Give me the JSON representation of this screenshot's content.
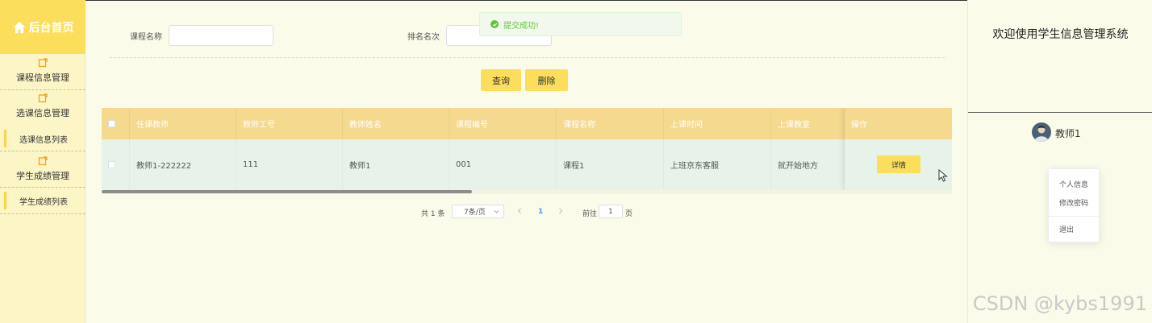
{
  "sidebar": {
    "brand": "后台首页",
    "groups": [
      {
        "label": "课程信息管理"
      },
      {
        "label": "选课信息管理",
        "subitems": [
          {
            "label": "选课信息列表"
          }
        ]
      },
      {
        "label": "学生成绩管理",
        "subitems": [
          {
            "label": "学生成绩列表"
          }
        ]
      }
    ]
  },
  "search": {
    "course_name_label": "课程名称",
    "course_name_value": "",
    "rank_label": "排名名次",
    "rank_value": ""
  },
  "toolbar": {
    "query_label": "查询",
    "delete_label": "删除"
  },
  "toast": {
    "message": "提交成功!"
  },
  "table": {
    "columns": [
      "任课教师",
      "教师工号",
      "教师姓名",
      "课程编号",
      "课程名称",
      "上课时间",
      "上课教室",
      "操作"
    ],
    "rows": [
      {
        "teacher": "教师1-222222",
        "teacher_no": "111",
        "teacher_name": "教师1",
        "course_no": "001",
        "course_name": "课程1",
        "time": "上班京东客服",
        "room": "就开始地方",
        "action": "详情"
      }
    ]
  },
  "pagination": {
    "total": "共 1 条",
    "page_size": "7条/页",
    "current": "1",
    "goto_label": "前往",
    "goto_value": "1",
    "page_suffix": "页"
  },
  "header": {
    "welcome": "欢迎使用学生信息管理系统"
  },
  "user": {
    "name": "教师1",
    "menu": [
      "个人信息",
      "修改密码",
      "退出"
    ]
  },
  "watermark": "CSDN @kybs1991",
  "colors": {
    "accent": "#fbde5b",
    "header_row": "#f4d98e",
    "body_row": "#e7f3e9",
    "success": "#67c23a"
  }
}
